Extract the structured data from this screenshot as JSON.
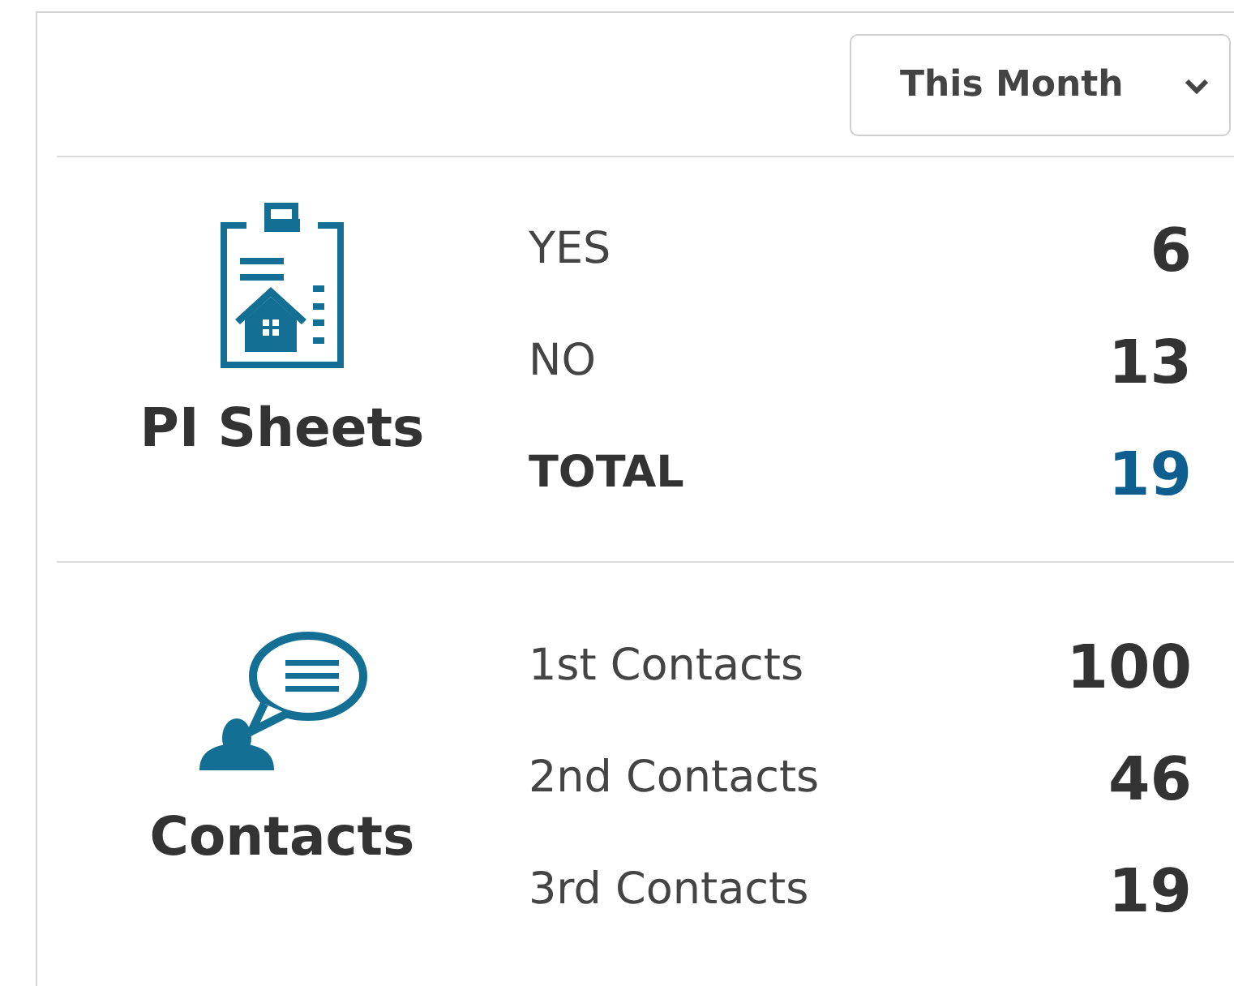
{
  "period_select": {
    "value": "This Month"
  },
  "sections": [
    {
      "kind": "clipboard",
      "title": "PI Sheets",
      "rows": [
        {
          "kind": "count",
          "label": "YES",
          "value": "6"
        },
        {
          "kind": "count",
          "label": "NO",
          "value": "13"
        },
        {
          "kind": "total",
          "label": "TOTAL",
          "value": "19"
        }
      ]
    },
    {
      "kind": "speech",
      "title": "Contacts",
      "rows": [
        {
          "kind": "count",
          "label": "1st Contacts",
          "value": "100"
        },
        {
          "kind": "count",
          "label": "2nd Contacts",
          "value": "46"
        },
        {
          "kind": "count",
          "label": "3rd Contacts",
          "value": "19"
        }
      ]
    }
  ]
}
